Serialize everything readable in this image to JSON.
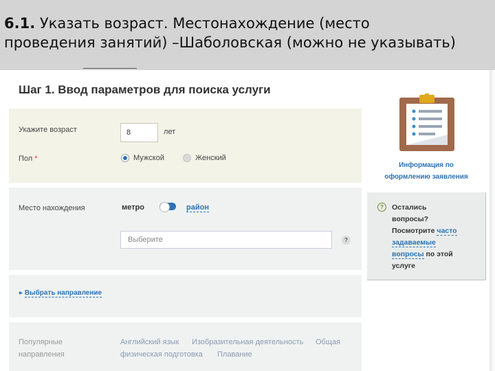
{
  "slide": {
    "number": "6.1.",
    "line1": "Указать возраст. Местонахождение  (место",
    "line2": "проведения занятий) –Шаболовская (можно не указывать)"
  },
  "form": {
    "title": "Шаг 1. Ввод параметров для поиска услуги",
    "age": {
      "label": "Укажите возраст",
      "value": "8",
      "unit": "лет"
    },
    "gender": {
      "label": "Пол",
      "required_mark": "*",
      "options": [
        {
          "label": "Мужской",
          "selected": true
        },
        {
          "label": "Женский",
          "selected": false
        }
      ]
    },
    "location": {
      "label": "Место нахождения",
      "toggle_left": "метро",
      "toggle_right": "район",
      "select_placeholder": "Выберите",
      "help_glyph": "?"
    },
    "direction": {
      "arrow": "▸",
      "link": "Выбрать направление"
    },
    "popular": {
      "label_line1": "Популярные",
      "label_line2": "направления",
      "links": [
        "Английский язык",
        "Изобразительная деятельность",
        "Общая",
        "физическая подготовка",
        "Плавание"
      ]
    }
  },
  "sidebar": {
    "info_link_line1": "Информация по",
    "info_link_line2": "оформлению заявления",
    "faq": {
      "icon_glyph": "?",
      "line1": "Остались",
      "line2": "вопросы?",
      "line3_text": "Посмотрите ",
      "line3_link": "часто",
      "line4_link": "задаваемые",
      "line5_link": "вопросы",
      "line5_text": " по этой",
      "line6": "услуге"
    }
  },
  "colors": {
    "accent": "#2b73b7",
    "header_bg": "#d4d4d4",
    "age_panel_bg": "#f4f3e8",
    "panel_bg": "#f0f2f2"
  }
}
